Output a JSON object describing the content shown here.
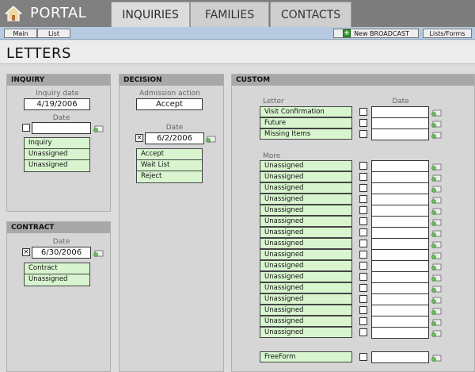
{
  "app": {
    "logo_text": "PORTAL"
  },
  "tabs": [
    {
      "label": "INQUIRIES",
      "active": true
    },
    {
      "label": "FAMILIES",
      "active": false
    },
    {
      "label": "CONTACTS",
      "active": false
    }
  ],
  "toolbar": {
    "main": "Main",
    "list": "List",
    "new_broadcast": "New BROADCAST",
    "lists_forms": "Lists/Forms"
  },
  "page_title": "LETTERS",
  "inquiry": {
    "header": "INQUIRY",
    "date_label": "Inquiry date",
    "date_value": "4/19/2006",
    "sub_date_label": "Date",
    "sub_date_value": "",
    "checked": false,
    "items": [
      "Inquiry",
      "Unassigned",
      "Unassigned"
    ]
  },
  "contract": {
    "header": "CONTRACT",
    "date_label": "Date",
    "date_value": "6/30/2006",
    "checked": true,
    "items": [
      "Contract",
      "Unassigned"
    ]
  },
  "decision": {
    "header": "DECISION",
    "action_label": "Admission action",
    "action_value": "Accept",
    "date_label": "Date",
    "date_value": "6/2/2006",
    "checked": true,
    "items": [
      "Accept",
      "Wait List",
      "Reject"
    ]
  },
  "custom": {
    "header": "CUSTOM",
    "letter_label": "Letter",
    "date_label": "Date",
    "letters": [
      "Visit Confirmation",
      "Future",
      "Missing Items"
    ],
    "more_label": "More",
    "more": [
      "Unassigned",
      "Unassigned",
      "Unassigned",
      "Unassigned",
      "Unassigned",
      "Unassigned",
      "Unassigned",
      "Unassigned",
      "Unassigned",
      "Unassigned",
      "Unassigned",
      "Unassigned",
      "Unassigned",
      "Unassigned",
      "Unassigned",
      "Unassigned"
    ],
    "freeform": "FreeForm"
  },
  "colors": {
    "accent_green": "#d8f5cf",
    "toolbar_blue": "#b6cbe1"
  }
}
